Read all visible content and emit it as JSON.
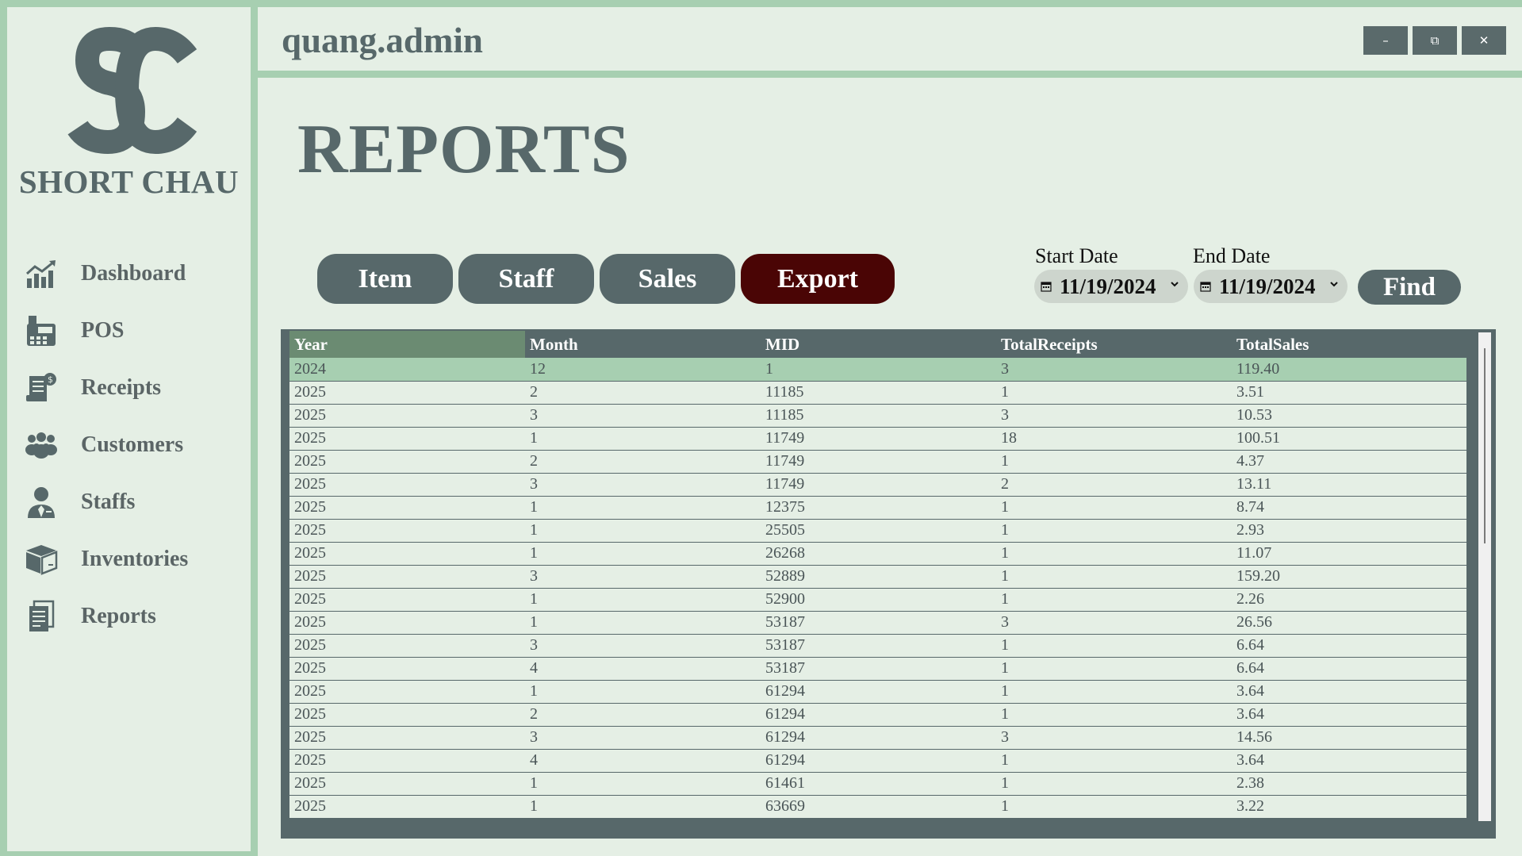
{
  "sidebar": {
    "logo_text": "SC",
    "brand": "SHORT CHAU",
    "items": [
      {
        "label": "Dashboard",
        "icon": "chart-icon"
      },
      {
        "label": "POS",
        "icon": "pos-terminal-icon"
      },
      {
        "label": "Receipts",
        "icon": "receipt-icon"
      },
      {
        "label": "Customers",
        "icon": "customers-icon"
      },
      {
        "label": "Staffs",
        "icon": "staff-icon"
      },
      {
        "label": "Inventories",
        "icon": "box-icon"
      },
      {
        "label": "Reports",
        "icon": "document-icon"
      }
    ]
  },
  "header": {
    "username": "quang.admin",
    "minimize": "–",
    "restore": "⧉",
    "close": "✕"
  },
  "main": {
    "title": "REPORTS",
    "tabs": {
      "item": "Item",
      "staff": "Staff",
      "sales": "Sales",
      "export": "Export"
    },
    "start_date": {
      "label": "Start Date",
      "value": "11/19/2024"
    },
    "end_date": {
      "label": "End Date",
      "value": "11/19/2024"
    },
    "find": "Find"
  },
  "table": {
    "columns": [
      "Year",
      "Month",
      "MID",
      "TotalReceipts",
      "TotalSales"
    ],
    "rows": [
      [
        "2024",
        "12",
        "1",
        "3",
        "119.40"
      ],
      [
        "2025",
        "2",
        "11185",
        "1",
        "3.51"
      ],
      [
        "2025",
        "3",
        "11185",
        "3",
        "10.53"
      ],
      [
        "2025",
        "1",
        "11749",
        "18",
        "100.51"
      ],
      [
        "2025",
        "2",
        "11749",
        "1",
        "4.37"
      ],
      [
        "2025",
        "3",
        "11749",
        "2",
        "13.11"
      ],
      [
        "2025",
        "1",
        "12375",
        "1",
        "8.74"
      ],
      [
        "2025",
        "1",
        "25505",
        "1",
        "2.93"
      ],
      [
        "2025",
        "1",
        "26268",
        "1",
        "11.07"
      ],
      [
        "2025",
        "3",
        "52889",
        "1",
        "159.20"
      ],
      [
        "2025",
        "1",
        "52900",
        "1",
        "2.26"
      ],
      [
        "2025",
        "1",
        "53187",
        "3",
        "26.56"
      ],
      [
        "2025",
        "3",
        "53187",
        "1",
        "6.64"
      ],
      [
        "2025",
        "4",
        "53187",
        "1",
        "6.64"
      ],
      [
        "2025",
        "1",
        "61294",
        "1",
        "3.64"
      ],
      [
        "2025",
        "2",
        "61294",
        "1",
        "3.64"
      ],
      [
        "2025",
        "3",
        "61294",
        "3",
        "14.56"
      ],
      [
        "2025",
        "4",
        "61294",
        "1",
        "3.64"
      ],
      [
        "2025",
        "1",
        "61461",
        "1",
        "2.38"
      ],
      [
        "2025",
        "1",
        "63669",
        "1",
        "3.22"
      ]
    ]
  },
  "colors": {
    "background": "#a7cfb1",
    "panel": "#e5efe5",
    "primary": "#57686a",
    "export": "#4a0505",
    "selected_row": "#a7cfb1"
  }
}
